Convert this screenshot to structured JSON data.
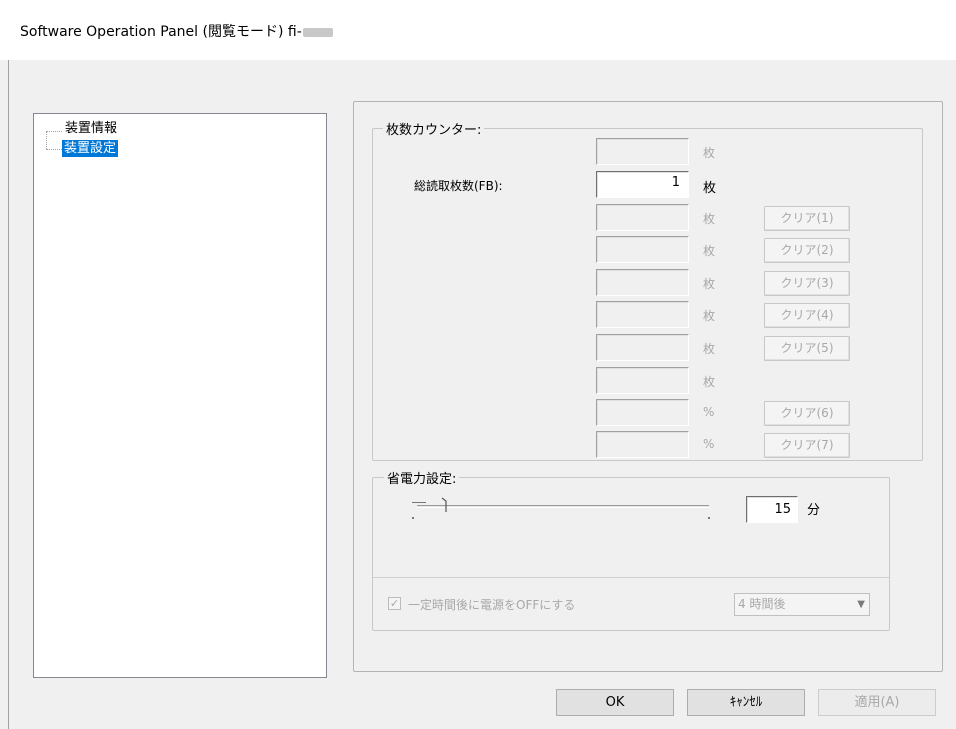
{
  "window": {
    "title": "Software Operation Panel (閲覧モード) fi-"
  },
  "tree": {
    "items": [
      {
        "label": "装置情報",
        "selected": false
      },
      {
        "label": "装置設定",
        "selected": true
      }
    ]
  },
  "counter_group": {
    "label": "枚数カウンター:",
    "total_label": "総読取枚数(FB):",
    "rows": [
      {
        "value": "",
        "unit": "枚",
        "button": ""
      },
      {
        "value": "1",
        "unit": "枚",
        "button": ""
      },
      {
        "value": "",
        "unit": "枚",
        "button": "クリア(1)"
      },
      {
        "value": "",
        "unit": "枚",
        "button": "クリア(2)"
      },
      {
        "value": "",
        "unit": "枚",
        "button": "クリア(3)"
      },
      {
        "value": "",
        "unit": "枚",
        "button": "クリア(4)"
      },
      {
        "value": "",
        "unit": "枚",
        "button": "クリア(5)"
      },
      {
        "value": "",
        "unit": "枚",
        "button": ""
      },
      {
        "value": "",
        "unit": "%",
        "button": "クリア(6)"
      },
      {
        "value": "",
        "unit": "%",
        "button": "クリア(7)"
      }
    ]
  },
  "power_group": {
    "label": "省電力設定:",
    "minutes_value": "15",
    "minutes_unit": "分",
    "auto_off_label": "一定時間後に電源をOFFにする",
    "auto_off_checked": true,
    "hours_selected": "4 時間後"
  },
  "buttons": {
    "ok": "OK",
    "cancel": "ｷｬﾝｾﾙ",
    "apply": "適用(A)"
  }
}
